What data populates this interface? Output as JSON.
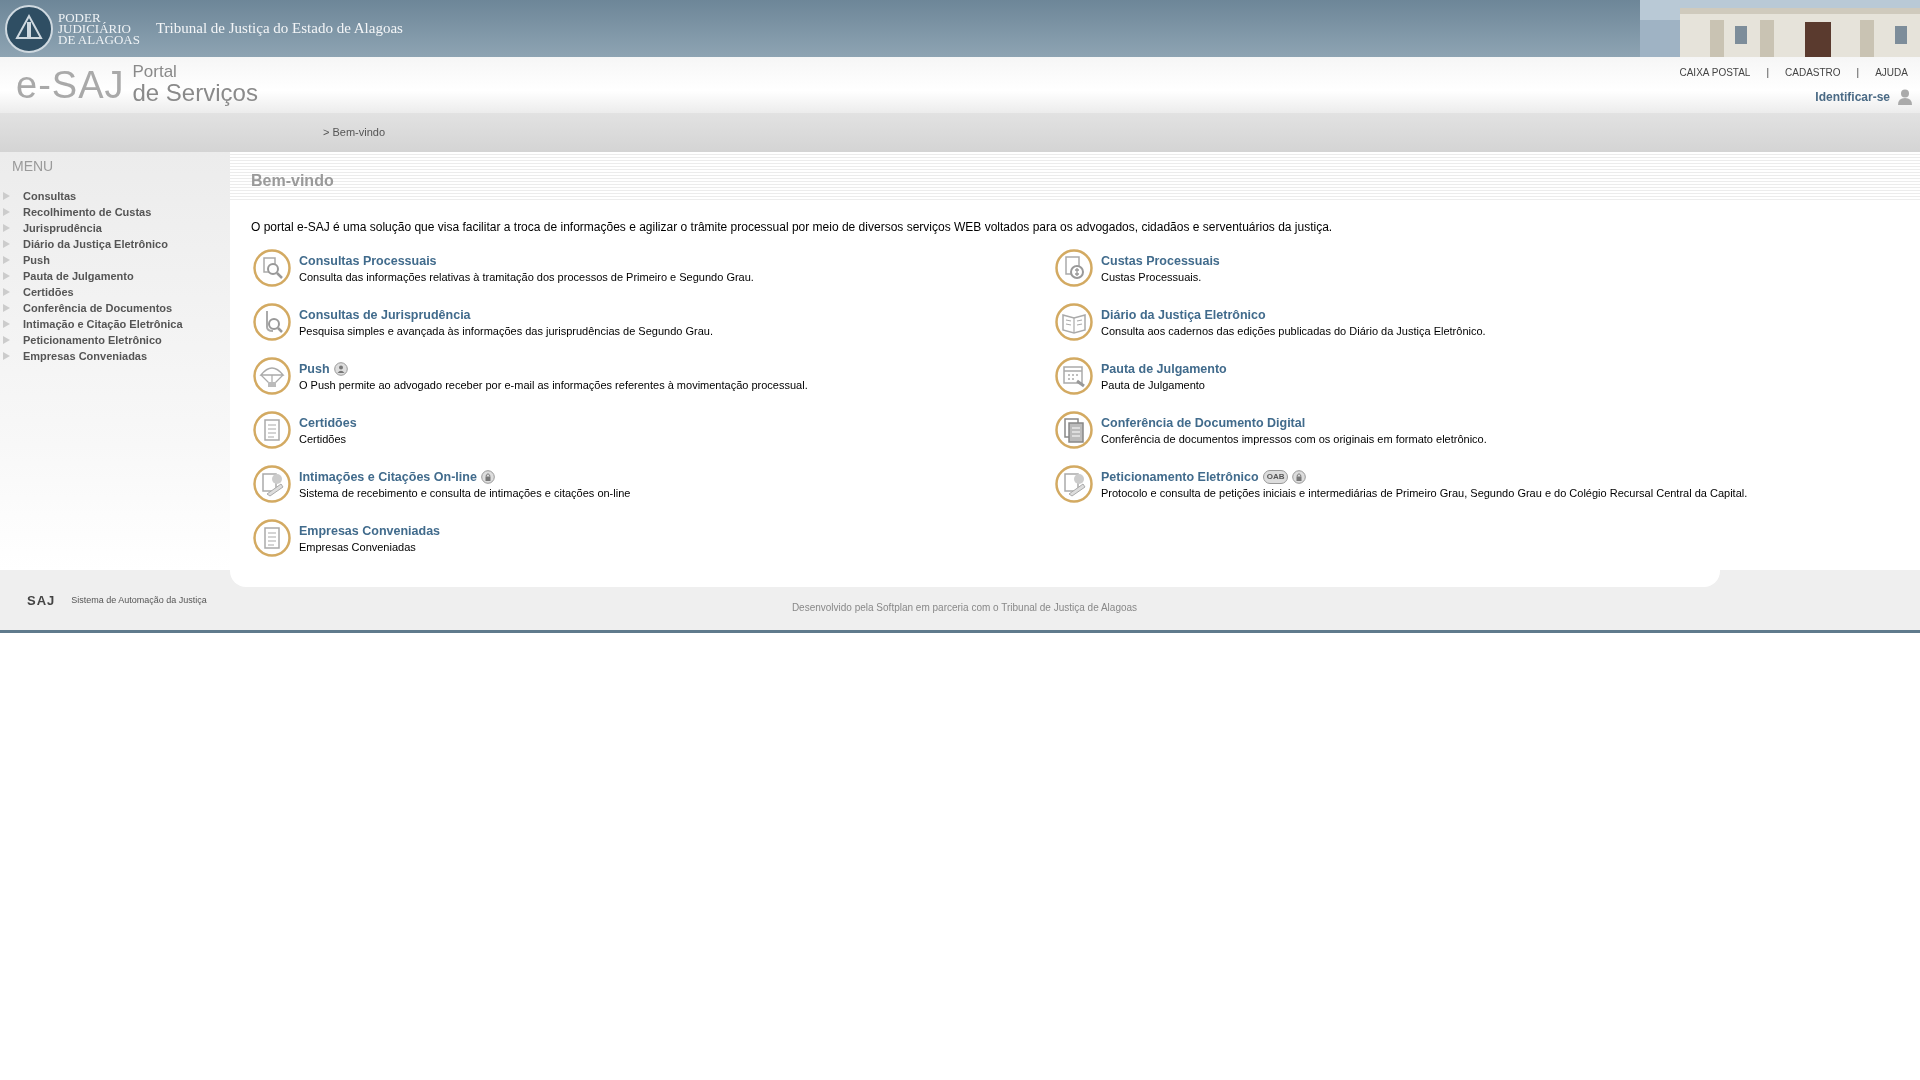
{
  "header": {
    "org_logo": {
      "lines": [
        "PODER",
        "JUDICIÁRIO",
        "DE ALAGOAS"
      ]
    },
    "title": "Tribunal de Justiça do Estado de Alagoas",
    "portal_logo": {
      "brand": "e-SAJ",
      "line_1": "Portal",
      "line_2": "de Serviços"
    },
    "top_links": [
      "CAIXA POSTAL",
      "CADASTRO",
      "AJUDA"
    ],
    "separator": "|",
    "login_link": "Identificar-se"
  },
  "breadcrumb": "> Bem-vindo",
  "sidebar": {
    "title": "MENU",
    "items": [
      "Consultas",
      "Recolhimento de Custas",
      "Jurisprudência",
      "Diário da Justiça Eletrônico",
      "Push",
      "Pauta de Julgamento",
      "Certidões",
      "Conferência de Documentos",
      "Intimação e Citação Eletrônica",
      "Peticionamento Eletrônico",
      "Empresas Conveniadas"
    ]
  },
  "content": {
    "heading": "Bem-vindo",
    "intro": "O portal e-SAJ é uma solução que visa facilitar a troca de informações e agilizar o trâmite processual por meio de diversos serviços WEB voltados para os advogados, cidadãos e serventuários da justiça.",
    "services": [
      {
        "title": "Consultas Processuais",
        "description": "Consulta das informações relativas à tramitação dos processos de Primeiro e Segundo Grau."
      },
      {
        "title": "Custas Processuais",
        "description": "Custas Processuais."
      },
      {
        "title": "Consultas de Jurisprudência",
        "description": "Pesquisa simples e avançada às informações das jurisprudências de Segundo Grau."
      },
      {
        "title": "Diário da Justiça Eletrônico",
        "description": "Consulta aos cadernos das edições publicadas do Diário da Justiça Eletrônico."
      },
      {
        "title": "Push",
        "badges": [
          {
            "kind": "user"
          }
        ],
        "description": "O Push permite ao advogado receber por e-mail as informações referentes à movimentação processual."
      },
      {
        "title": "Pauta de Julgamento",
        "description": "Pauta de Julgamento"
      },
      {
        "title": "Certidões",
        "description": "Certidões"
      },
      {
        "title": "Conferência de Documento Digital",
        "description": "Conferência de documentos impressos com os originais em formato eletrônico."
      },
      {
        "title": "Intimações e Citações On-line",
        "badges": [
          {
            "kind": "lock"
          }
        ],
        "description": "Sistema de recebimento e consulta de intimações e citações on-line"
      },
      {
        "title": "Peticionamento Eletrônico",
        "badges": [
          {
            "kind": "text",
            "text": "OAB"
          },
          {
            "kind": "lock"
          }
        ],
        "description": "Protocolo e consulta de petições iniciais e intermediárias de Primeiro Grau, Segundo Grau e do Colégio Recursal Central da Capital."
      },
      {
        "title": "Empresas Conveniadas",
        "description": "Empresas Conveniadas"
      }
    ]
  },
  "footer": {
    "logo": "SAJ",
    "system_name": "Sistema de Automação da Justiça",
    "credits": "Desenvolvido pela Softplan em parceria com o Tribunal de Justiça de Alagoas"
  }
}
